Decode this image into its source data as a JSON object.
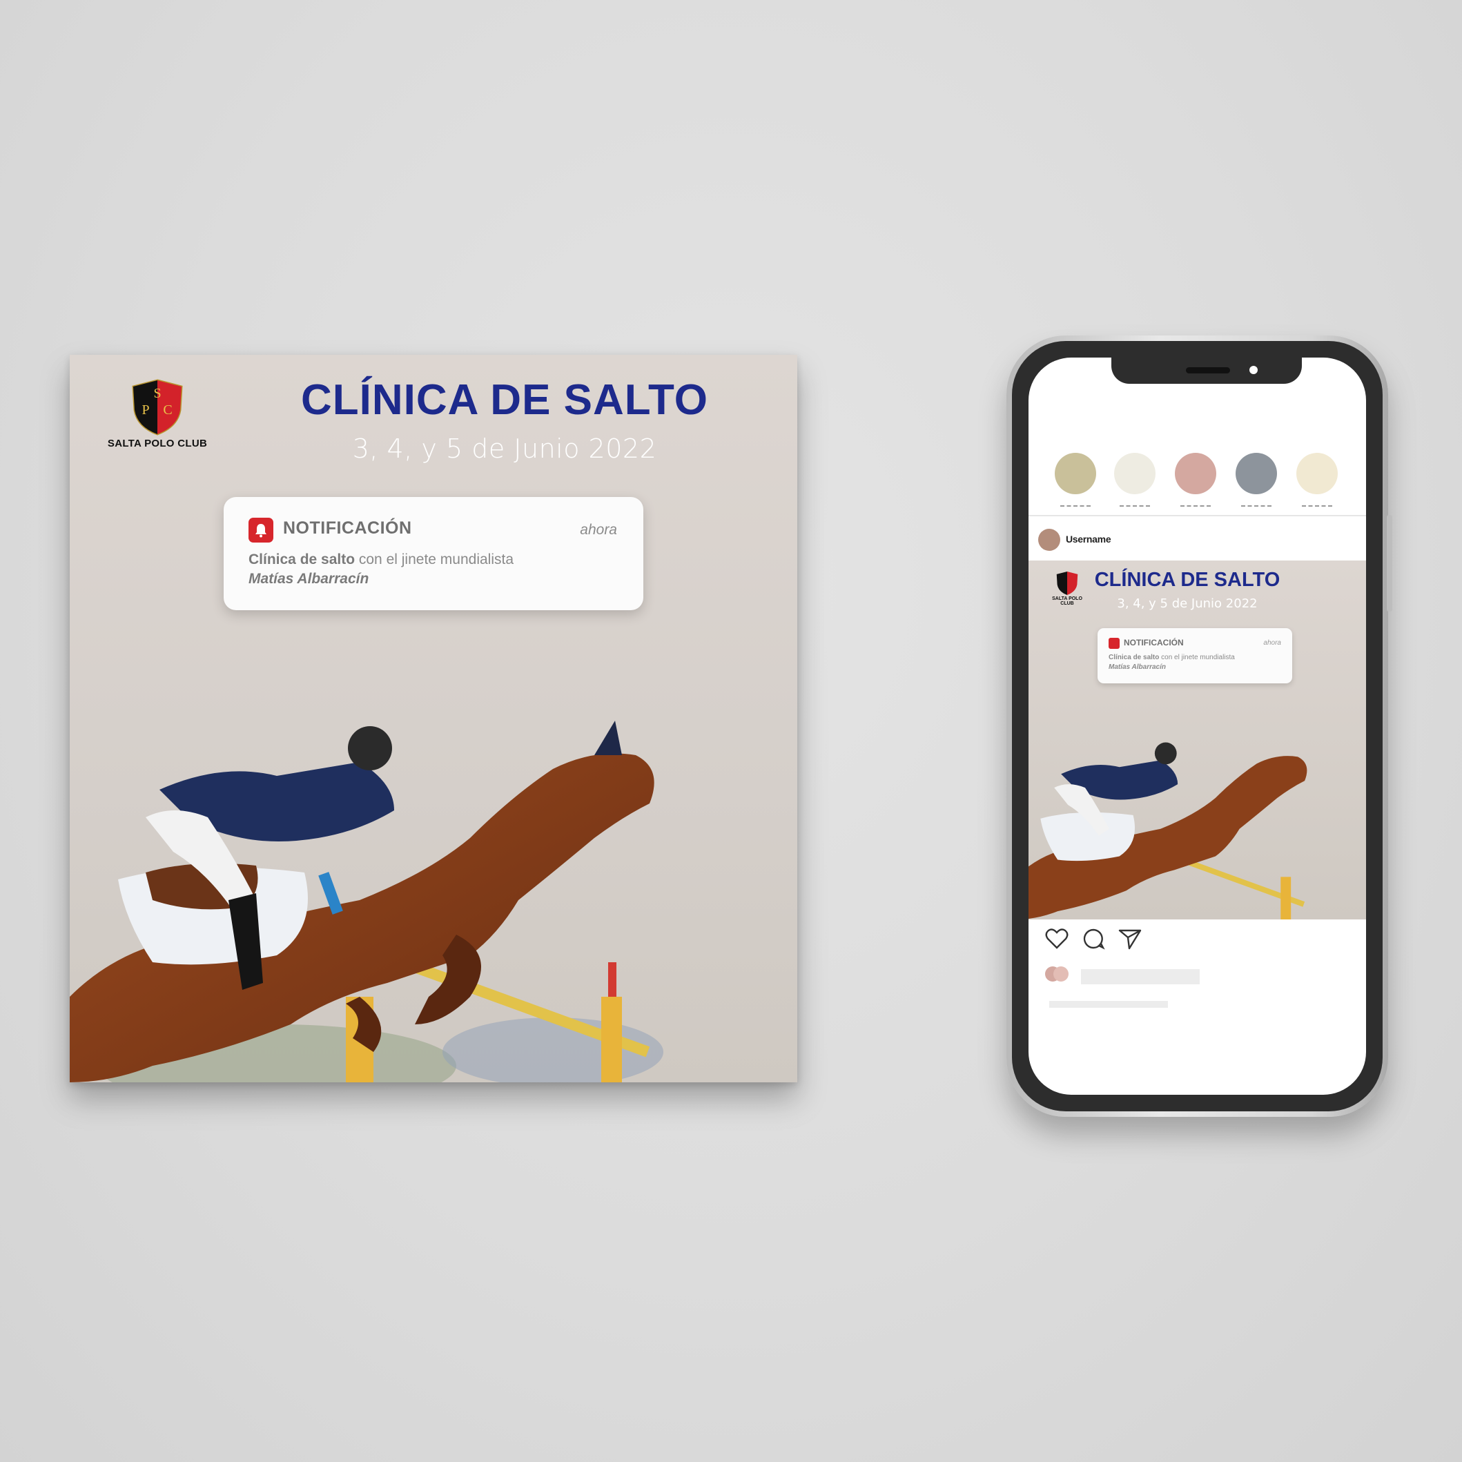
{
  "poster": {
    "logo_letters": [
      "S",
      "P",
      "C"
    ],
    "logo_text": "SALTA POLO CLUB",
    "title": "CLÍNICA DE SALTO",
    "subtitle": "3, 4, y 5 de Junio 2022",
    "notification": {
      "title": "NOTIFICACIÓN",
      "time": "ahora",
      "body_bold": "Clínica de salto",
      "body_rest": " con el jinete mundialista",
      "body_italic": "Matías Albarracín"
    }
  },
  "phone": {
    "stories": [
      {
        "color": "#c9c09a"
      },
      {
        "color": "#eeece2"
      },
      {
        "color": "#d4a8a0"
      },
      {
        "color": "#8d949c"
      },
      {
        "color": "#f1e9d2"
      }
    ],
    "post_user": "Username",
    "post": {
      "logo_text": "SALTA POLO CLUB",
      "title": "CLÍNICA DE SALTO",
      "subtitle": "3, 4, y 5 de Junio 2022",
      "notification": {
        "title": "NOTIFICACIÓN",
        "time": "ahora",
        "body_bold": "Clínica de salto",
        "body_rest": " con el jinete mundialista",
        "body_italic": "Matías Albarracín"
      }
    },
    "actions": [
      "heart-icon",
      "comment-icon",
      "share-icon"
    ],
    "like_colors": [
      "#d4a8a0",
      "#e3bdb5"
    ]
  },
  "colors": {
    "brand_blue": "#1d2a8c",
    "notification_red": "#d7262c"
  }
}
